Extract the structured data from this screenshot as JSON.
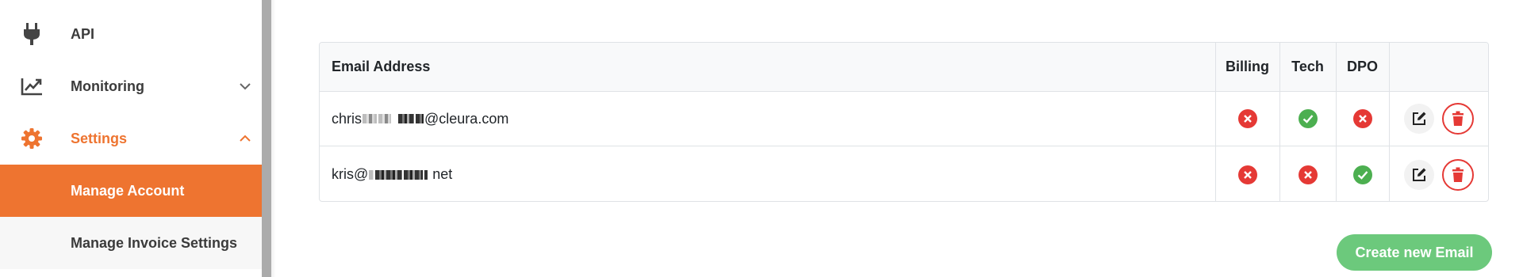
{
  "sidebar": {
    "items": [
      {
        "label": "API",
        "icon": "plug-icon"
      },
      {
        "label": "Monitoring",
        "icon": "chart-line-icon",
        "chevron": "chevron-down-icon"
      },
      {
        "label": "Settings",
        "icon": "gear-icon",
        "chevron": "chevron-up-icon"
      },
      {
        "label": "Manage Account"
      },
      {
        "label": "Manage Invoice Settings"
      }
    ]
  },
  "table": {
    "headers": {
      "email": "Email Address",
      "billing": "Billing",
      "tech": "Tech",
      "dpo": "DPO",
      "actions": ""
    },
    "rows": [
      {
        "email_prefix": "chris",
        "email_suffix": "@cleura.com",
        "billing": false,
        "tech": true,
        "dpo": false
      },
      {
        "email_prefix": "kris@",
        "email_suffix": "net",
        "billing": false,
        "tech": false,
        "dpo": true
      }
    ]
  },
  "create_button": {
    "label": "Create new Email"
  },
  "colors": {
    "accent": "#ee7430",
    "success": "#4caf50",
    "danger": "#e53935",
    "create": "#6cc97c"
  }
}
